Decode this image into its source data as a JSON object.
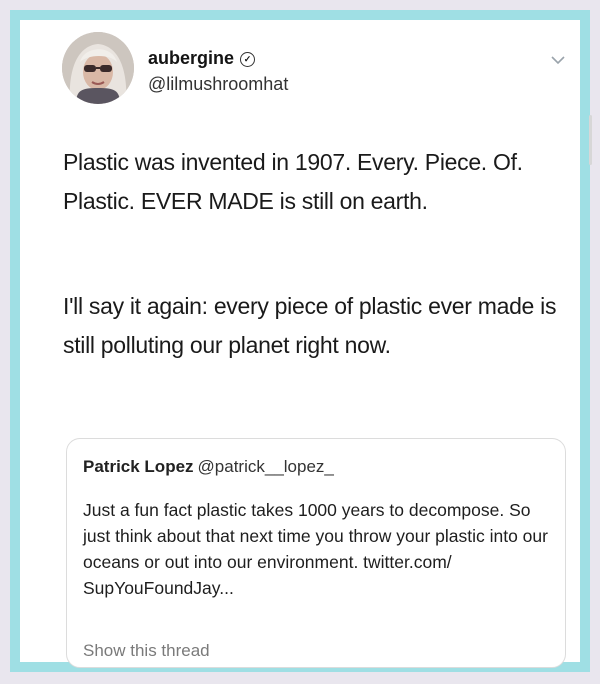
{
  "tweet": {
    "display_name": "aubergine",
    "handle": "@lilmushroomhat",
    "paragraphs": [
      "Plastic was invented in 1907. Every. Piece. Of. Plastic. EVER MADE is still on earth.",
      "I'll say it again: every piece of plastic ever made is still polluting our planet right now."
    ]
  },
  "quoted_tweet": {
    "display_name": "Patrick Lopez",
    "handle": "@patrick__lopez_",
    "text": "Just a fun fact plastic takes 1000 years to decompose. So just think about that next time you throw your plastic into our oceans or out into our environment. twitter.com/ SupYouFoundJay...",
    "show_thread_label": "Show this thread"
  },
  "icons": {
    "verified": "verified-badge-icon",
    "menu": "chevron-down-icon"
  },
  "colors": {
    "frame": "#9fdfe4",
    "background": "#e9e6ee",
    "card": "#ffffff"
  }
}
